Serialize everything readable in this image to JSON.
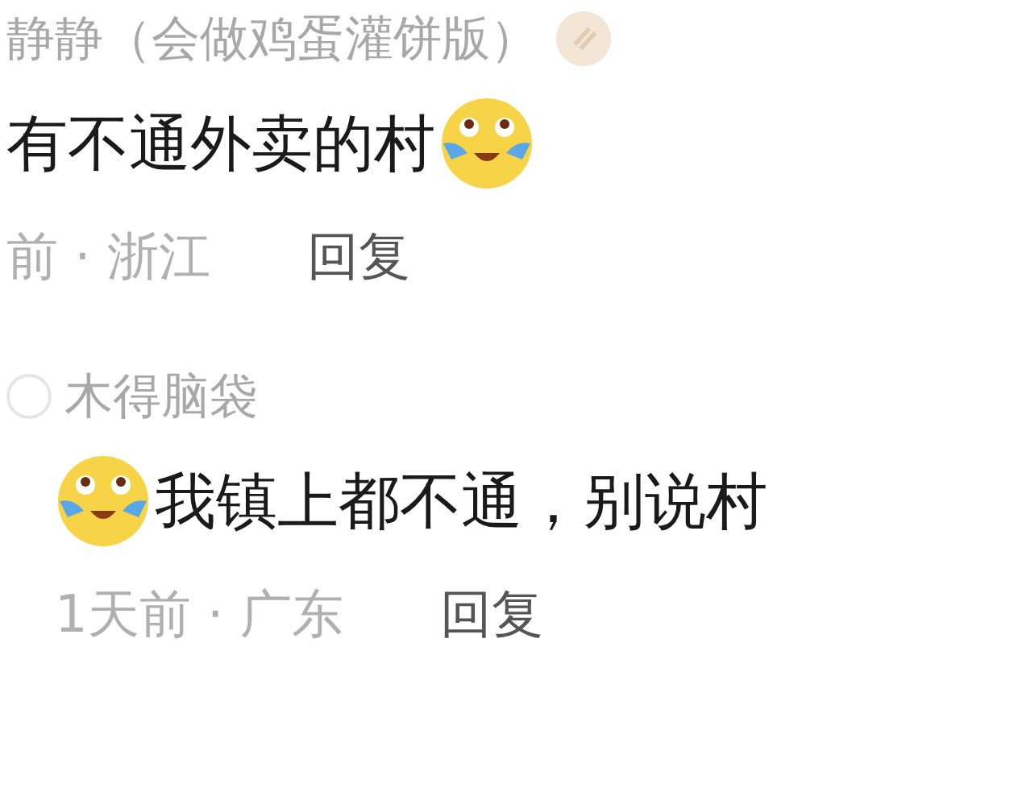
{
  "comments": [
    {
      "user": "静静（会做鸡蛋灌饼版）",
      "badge": true,
      "avatar": false,
      "emoji_first": false,
      "text": "有不通外卖的村",
      "meta": "前 · 浙江",
      "reply": "回复",
      "children": [
        {
          "user": "木得脑袋",
          "badge": false,
          "avatar": true,
          "emoji_first": true,
          "text": "我镇上都不通，别说村",
          "meta": "1天前 · 广东",
          "reply": "回复"
        }
      ]
    }
  ]
}
